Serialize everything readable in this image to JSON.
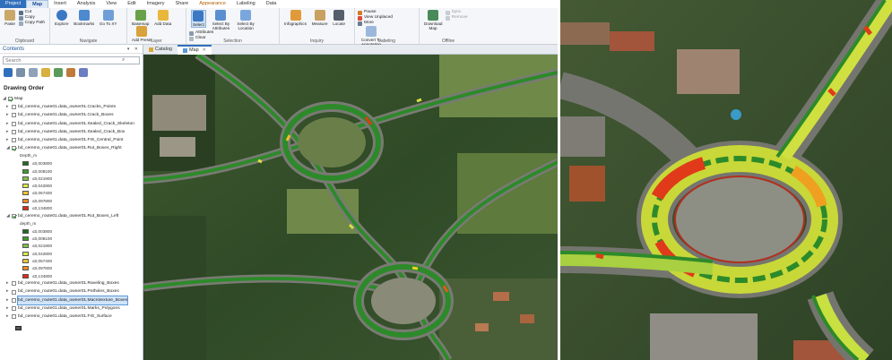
{
  "ribbon": {
    "tabs": [
      "Project",
      "Map",
      "Insert",
      "Analysis",
      "View",
      "Edit",
      "Imagery",
      "Share",
      "Appearance",
      "Labeling",
      "Data"
    ],
    "clipboard": {
      "paste": "Paste",
      "cut": "Cut",
      "copy": "Copy",
      "copy_path": "Copy Path",
      "label": "Clipboard"
    },
    "navigate": {
      "explore": "Explore",
      "bookmarks": "Bookmarks",
      "goto": "Go To XY",
      "label": "Navigate"
    },
    "layer": {
      "basemap": "Basemap",
      "add_data": "Add Data",
      "add_preset": "Add Preset",
      "label": "Layer"
    },
    "selection": {
      "select": "Select",
      "select_by_attributes": "Select By Attributes",
      "select_by_location": "Select By Location",
      "attributes": "Attributes",
      "clear": "Clear",
      "label": "Selection"
    },
    "inquiry": {
      "infographics": "Infographics",
      "measure": "Measure",
      "locate": "Locate",
      "label": "Inquiry"
    },
    "labeling": {
      "pause": "Pause",
      "view_unplaced": "View Unplaced",
      "more": "More",
      "convert": "Convert To Annotation",
      "label": "Labeling"
    },
    "offline": {
      "download": "Download Map",
      "sync": "Sync",
      "remove": "Remove",
      "label": "Offline"
    }
  },
  "contents": {
    "title": "Contents",
    "search_placeholder": "Search",
    "drawing_order": "Drawing Order",
    "map_root": "Map",
    "layers": [
      "bd_ceremo_route01.data_owner01.Cracks_Points",
      "bd_ceremo_route01.data_owner01.Crack_Boxes",
      "bd_ceremo_route01.data_owner01.Sealed_Crack_Skeleton",
      "bd_ceremo_route01.data_owner01.Sealed_Crack_Box",
      "bd_ceremo_route01.data_owner01.FIS_Central_Point",
      "bd_ceremo_route01.data_owner01.Rut_Boxes_Right"
    ],
    "legend_field": "Depth_m",
    "legend_values": [
      "≤0,003800",
      "≤0,008100",
      "≤0,021900",
      "≤0,042800",
      "≤0,067400",
      "≤0,097800",
      "≤0,134800"
    ],
    "legend_colors": [
      "#1e6b1e",
      "#3c9a2a",
      "#7cc24a",
      "#d8e84a",
      "#f4c430",
      "#f08a24",
      "#e02a1a"
    ],
    "layer_left": "bd_ceremo_route01.data_owner01.Rut_Boxes_Left",
    "legend_field_left": "depth_m",
    "legend_values_left": [
      "≤0,003800",
      "≤0,008100",
      "≤0,021900",
      "≤0,042800",
      "≤0,067400",
      "≤0,097800",
      "≤0,134800"
    ],
    "layers_bottom": [
      "bd_ceremo_route01.data_owner01.Raveling_Boxes",
      "bd_ceremo_route01.data_owner01.Potholes_Boxes",
      "bd_ceremo_route01.data_owner01.Macrotexture_Boxes",
      "bd_ceremo_route01.data_owner01.Marks_Polygons",
      "bd_ceremo_route01.data_owner01.FIS_Surface"
    ]
  },
  "map_tabs": {
    "catalog": "Catalog",
    "map": "Map"
  }
}
